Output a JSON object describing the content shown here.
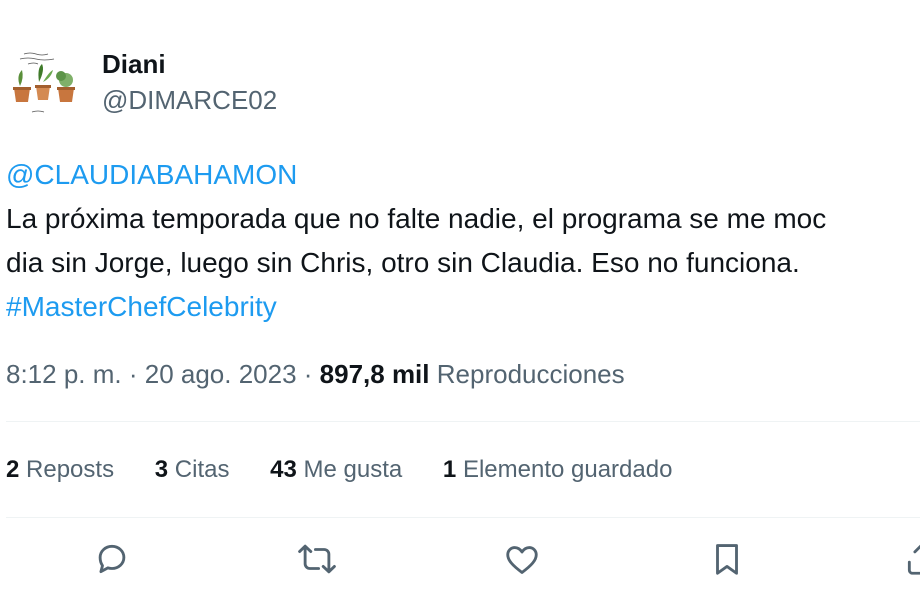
{
  "author": {
    "name": "Diani",
    "handle": "@DIMARCE02",
    "avatar_icon": "plant-pots-avatar"
  },
  "tweet": {
    "mention": "@CLAUDIABAHAMON",
    "line1": "La próxima temporada que no falte nadie, el programa se me moc",
    "line2": "dia sin Jorge, luego sin Chris, otro sin Claudia. Eso no funciona.",
    "hashtag": "#MasterChefCelebrity"
  },
  "meta": {
    "time": "8:12 p. m.",
    "separator": " · ",
    "date": "20 ago. 2023",
    "views_count": "897,8 mil",
    "views_label": "Reproducciones"
  },
  "stats": {
    "reposts_count": "2",
    "reposts_label": "Reposts",
    "quotes_count": "3",
    "quotes_label": "Citas",
    "likes_count": "43",
    "likes_label": "Me gusta",
    "bookmarks_count": "1",
    "bookmarks_label": "Elemento guardado"
  },
  "actions": [
    "reply-icon",
    "repost-icon",
    "like-icon",
    "bookmark-icon"
  ],
  "colors": {
    "link": "#1d9bf0",
    "text": "#0f1419",
    "secondary": "#536471",
    "divider": "#eff3f4"
  }
}
